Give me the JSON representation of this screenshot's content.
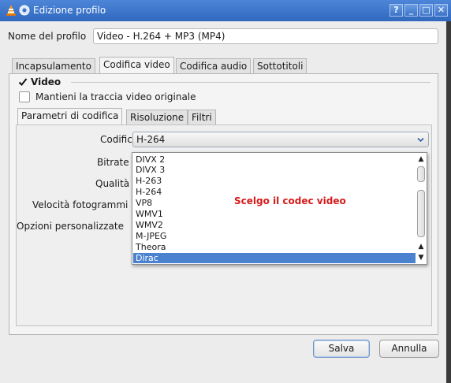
{
  "window": {
    "title": "Edizione profilo",
    "buttons": {
      "help": "?",
      "minimize": "_",
      "maximize": "□",
      "close": "✕"
    }
  },
  "profile": {
    "name_label": "Nome del profilo",
    "name_value": "Video - H.264 + MP3 (MP4)"
  },
  "tabs": [
    "Incapsulamento",
    "Codifica video",
    "Codifica audio",
    "Sottotitoli"
  ],
  "active_tab": "Codifica video",
  "video": {
    "group_label": "Video",
    "keep_original": "Mantieni la traccia video originale",
    "subtabs": [
      "Parametri di codifica",
      "Risoluzione",
      "Filtri"
    ],
    "fields": {
      "codec_label": "Codifica",
      "codec_value": "H-264",
      "bitrate_label": "Bitrate",
      "quality_label": "Qualità",
      "framerate_label": "Velocità fotogrammi",
      "custom_label": "Opzioni personalizzate"
    },
    "codec_options": [
      "DIVX 2",
      "DIVX 3",
      "H-263",
      "H-264",
      "VP8",
      "WMV1",
      "WMV2",
      "M-JPEG",
      "Theora",
      "Dirac"
    ],
    "selected_option": "Dirac"
  },
  "annotation": "Scelgo il codec video",
  "footer": {
    "save": "Salva",
    "cancel": "Annulla"
  },
  "colors": {
    "titlebar": "#3c74c8",
    "selection": "#4a82cf",
    "annotation": "#d61a1a"
  }
}
